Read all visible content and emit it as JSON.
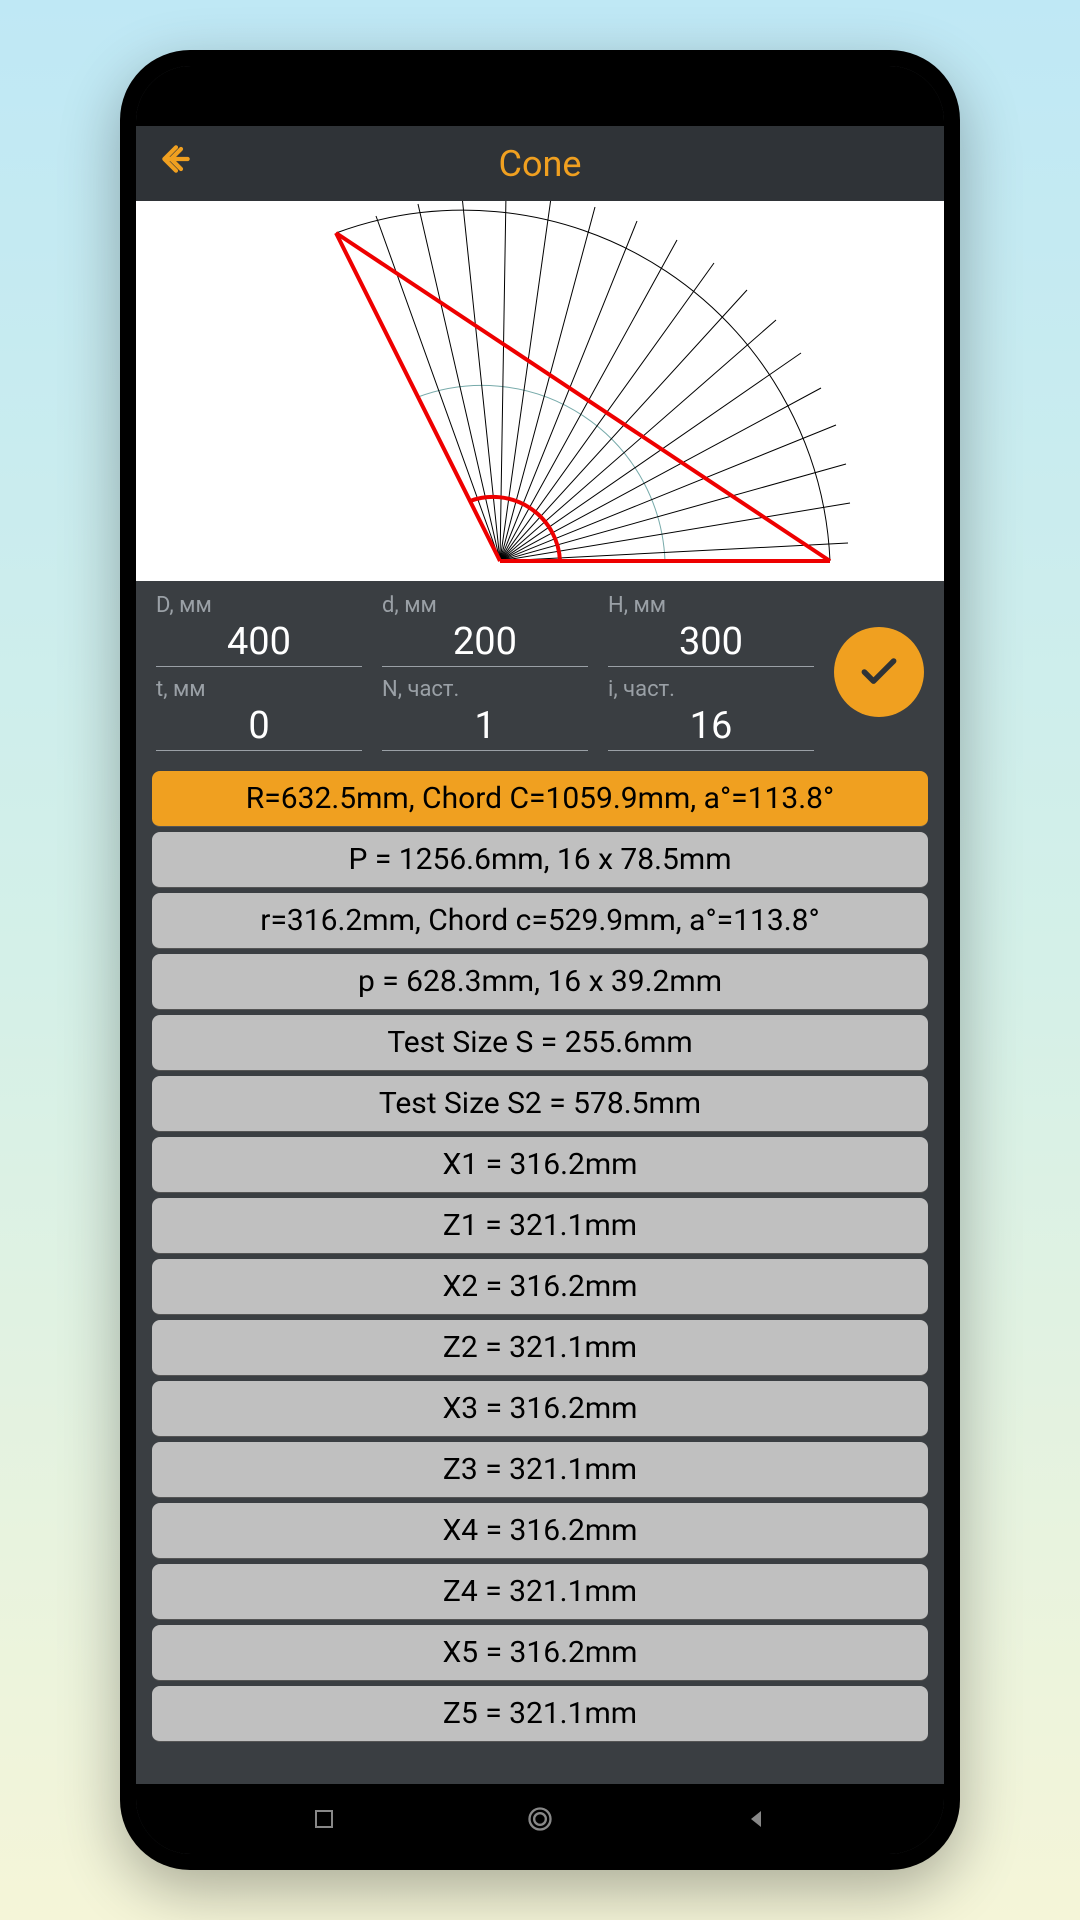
{
  "header": {
    "title": "Cone"
  },
  "inputs": {
    "D": {
      "label": "D, мм",
      "value": "400"
    },
    "d": {
      "label": "d, мм",
      "value": "200"
    },
    "H": {
      "label": "H, мм",
      "value": "300"
    },
    "t": {
      "label": "t, мм",
      "value": "0"
    },
    "N": {
      "label": "N, част.",
      "value": "1"
    },
    "i": {
      "label": "i, част.",
      "value": "16"
    }
  },
  "results": [
    {
      "text": "R=632.5mm, Chord C=1059.9mm, a°=113.8°",
      "highlighted": true
    },
    {
      "text": "P = 1256.6mm,   16 x 78.5mm",
      "highlighted": false
    },
    {
      "text": "r=316.2mm, Chord c=529.9mm, a°=113.8°",
      "highlighted": false
    },
    {
      "text": "p = 628.3mm,   16 x 39.2mm",
      "highlighted": false
    },
    {
      "text": "Test Size S = 255.6mm",
      "highlighted": false
    },
    {
      "text": "Test Size S2 = 578.5mm",
      "highlighted": false
    },
    {
      "text": "X1 = 316.2mm",
      "highlighted": false
    },
    {
      "text": "Z1 = 321.1mm",
      "highlighted": false
    },
    {
      "text": "X2 = 316.2mm",
      "highlighted": false
    },
    {
      "text": "Z2 = 321.1mm",
      "highlighted": false
    },
    {
      "text": "X3 = 316.2mm",
      "highlighted": false
    },
    {
      "text": "Z3 = 321.1mm",
      "highlighted": false
    },
    {
      "text": "X4 = 316.2mm",
      "highlighted": false
    },
    {
      "text": "Z4 = 321.1mm",
      "highlighted": false
    },
    {
      "text": "X5 = 316.2mm",
      "highlighted": false
    },
    {
      "text": "Z5 = 321.1mm",
      "highlighted": false
    }
  ]
}
